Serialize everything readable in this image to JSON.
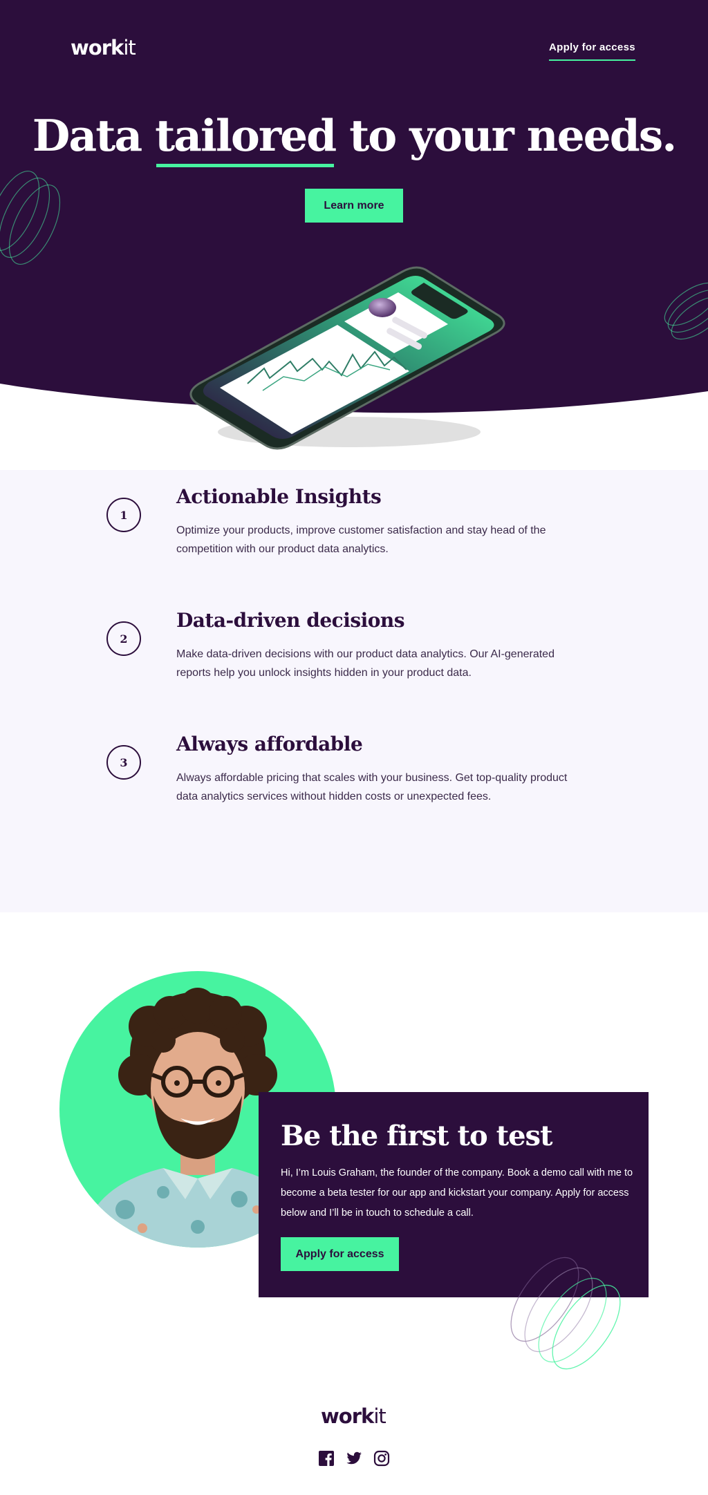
{
  "brand": {
    "logo_bold": "work",
    "logo_light": "it"
  },
  "nav": {
    "apply_label": "Apply for access"
  },
  "hero": {
    "title_before": "Data",
    "title_highlight": "tailored",
    "title_after": "to your needs.",
    "learn_more_label": "Learn more"
  },
  "features": [
    {
      "number": "1",
      "title": "Actionable Insights",
      "text": "Optimize your products, improve customer satisfaction and stay head of the competition with our product data analytics."
    },
    {
      "number": "2",
      "title": "Data-driven decisions",
      "text": "Make data-driven decisions with our product data analytics. Our AI-generated reports help you unlock insights hidden in your product data."
    },
    {
      "number": "3",
      "title": "Always affordable",
      "text": "Always affordable pricing that scales with your business. Get top-quality product data analytics services without hidden costs or unexpected fees."
    }
  ],
  "cta": {
    "title": "Be the first to test",
    "text": "Hi, I’m Louis Graham, the founder of the company. Book a demo call with me to become a beta tester for our app and kickstart your company. Apply for access below and I’ll be in touch to schedule a call.",
    "button_label": "Apply for access"
  },
  "footer": {
    "social_icons": [
      "facebook-icon",
      "twitter-icon",
      "instagram-icon"
    ]
  },
  "colors": {
    "dark_purple": "#2c0e3c",
    "green": "#47f3a0",
    "light_bg": "#f8f6fd"
  }
}
